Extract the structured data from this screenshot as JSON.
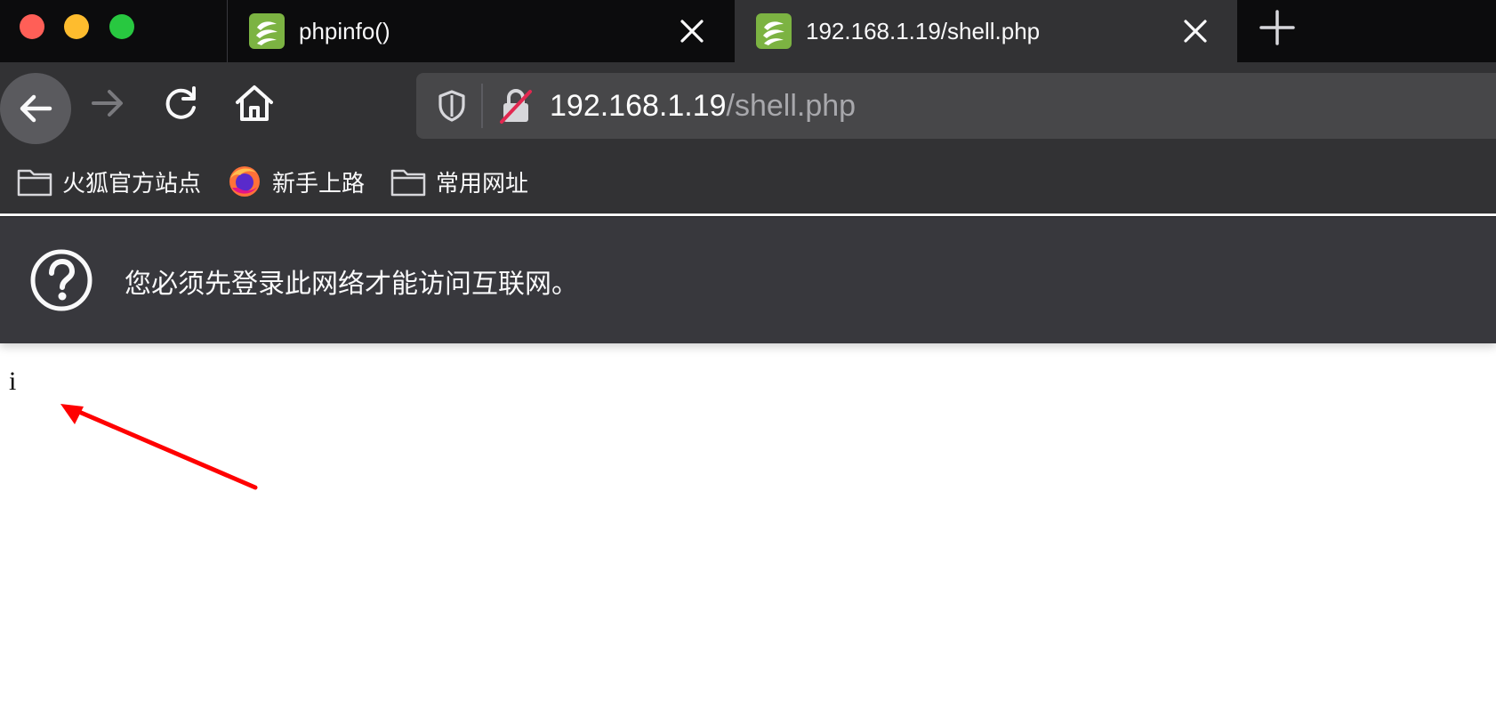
{
  "browser": {
    "tabs": [
      {
        "title": "phpinfo()",
        "active": false
      },
      {
        "title": "192.168.1.19/shell.php",
        "active": true
      }
    ],
    "url": {
      "host": "192.168.1.19",
      "path": "/shell.php"
    },
    "bookmarks": [
      {
        "label": "火狐官方站点",
        "icon": "folder-icon"
      },
      {
        "label": "新手上路",
        "icon": "firefox-icon"
      },
      {
        "label": "常用网址",
        "icon": "folder-icon"
      }
    ],
    "notification": {
      "text": "您必须先登录此网络才能访问互联网。",
      "icon": "question-circle-icon"
    }
  },
  "page": {
    "body_text": "i"
  },
  "annotation": {
    "type": "arrow",
    "color": "#ff0000"
  },
  "colors": {
    "tabstrip": "#0c0c0d",
    "toolbar": "#323234",
    "urlbar": "#474749",
    "notification": "#38383d",
    "favicon_green": "#7cb342"
  }
}
